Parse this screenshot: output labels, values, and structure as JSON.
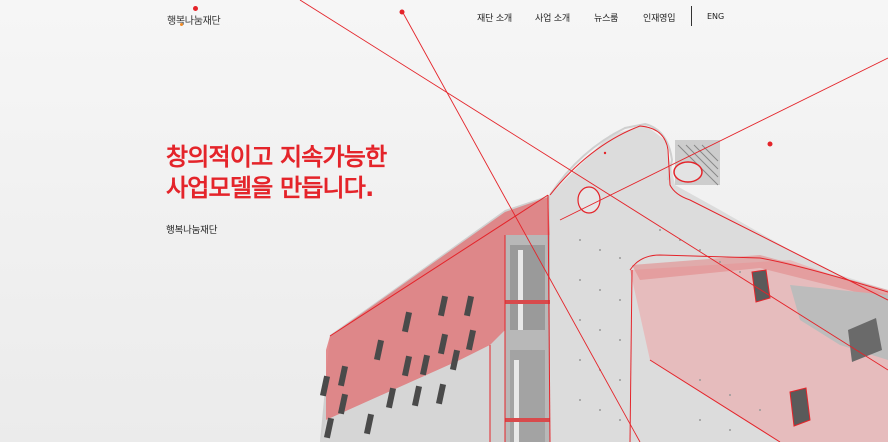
{
  "header": {
    "logo_text": "행복나눔재단",
    "nav": [
      {
        "label": "재단 소개"
      },
      {
        "label": "사업 소개"
      },
      {
        "label": "뉴스룸"
      },
      {
        "label": "인재영입"
      }
    ],
    "lang_label": "ENG"
  },
  "hero": {
    "headline_line1": "창의적이고 지속가능한",
    "headline_line2": "사업모델을 만듭니다.",
    "subtitle": "행복나눔재단"
  },
  "colors": {
    "accent": "#e4242a",
    "background": "#f1f1f1",
    "concrete": "#c9c9c9"
  }
}
